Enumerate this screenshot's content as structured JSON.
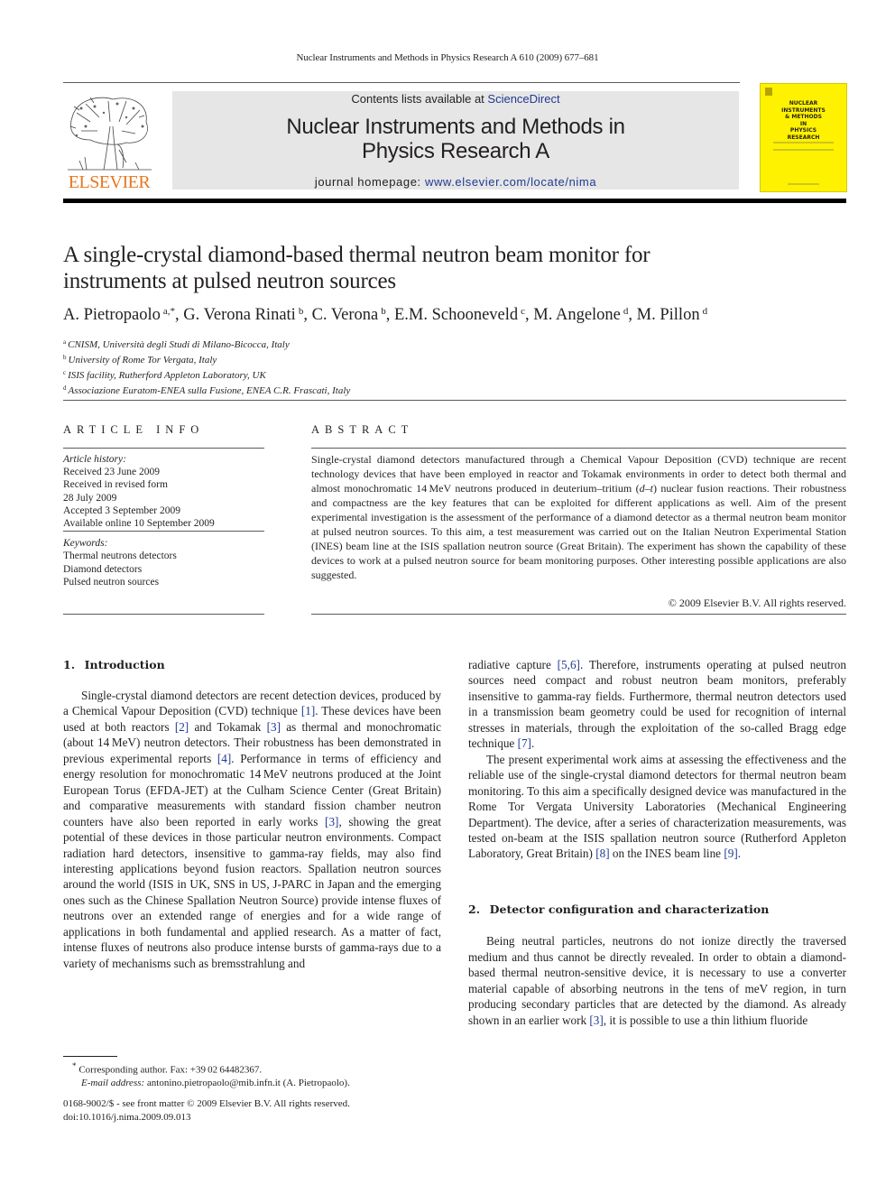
{
  "running_head": "Nuclear Instruments and Methods in Physics Research A 610 (2009) 677–681",
  "masthead": {
    "publisher_logo_text": "ELSEVIER",
    "contents_prefix": "Contents lists available at ",
    "contents_link": "ScienceDirect",
    "journal_title_line1": "Nuclear Instruments and Methods in",
    "journal_title_line2": "Physics Research A",
    "homepage_prefix": "journal homepage: ",
    "homepage_link": "www.elsevier.com/locate/nima",
    "cover_title_lines": [
      "NUCLEAR",
      "INSTRUMENTS",
      "& METHODS",
      "IN",
      "PHYSICS",
      "RESEARCH"
    ],
    "link_color": "#1f3a93",
    "logo_color": "#e87722",
    "cover_color": "#fff200"
  },
  "article": {
    "title_line1": "A single-crystal diamond-based thermal neutron beam monitor for",
    "title_line2": "instruments at pulsed neutron sources",
    "authors": [
      {
        "name": "A. Pietropaolo",
        "aff": "a,*"
      },
      {
        "name": "G. Verona Rinati",
        "aff": "b"
      },
      {
        "name": "C. Verona",
        "aff": "b"
      },
      {
        "name": "E.M. Schooneveld",
        "aff": "c"
      },
      {
        "name": "M. Angelone",
        "aff": "d"
      },
      {
        "name": "M. Pillon",
        "aff": "d"
      }
    ],
    "affiliations": [
      {
        "key": "a",
        "text": "CNISM, Università degli Studi di Milano-Bicocca, Italy"
      },
      {
        "key": "b",
        "text": "University of Rome Tor Vergata, Italy"
      },
      {
        "key": "c",
        "text": "ISIS facility, Rutherford Appleton Laboratory, UK"
      },
      {
        "key": "d",
        "text": "Associazione Euratom-ENEA sulla Fusione, ENEA C.R. Frascati, Italy"
      }
    ]
  },
  "article_info": {
    "heading": "ARTICLE INFO",
    "history_label": "Article history:",
    "history": [
      "Received 23 June 2009",
      "Received in revised form",
      "28 July 2009",
      "Accepted 3 September 2009",
      "Available online 10 September 2009"
    ],
    "keywords_label": "Keywords:",
    "keywords": [
      "Thermal neutrons detectors",
      "Diamond detectors",
      "Pulsed neutron sources"
    ]
  },
  "abstract": {
    "heading": "ABSTRACT",
    "text_part1": "Single-crystal diamond detectors manufactured through a Chemical Vapour Deposition (CVD) technique are recent technology devices that have been employed in reactor and Tokamak environments in order to detect both thermal and almost monochromatic 14 MeV neutrons produced in deuterium–tritium (",
    "text_italic": "d–t",
    "text_part2": ") nuclear fusion reactions. Their robustness and compactness are the key features that can be exploited for different applications as well. Aim of the present experimental investigation is the assessment of the performance of a diamond detector as a thermal neutron beam monitor at pulsed neutron sources. To this aim, a test measurement was carried out on the Italian Neutron Experimental Station (INES) beam line at the ISIS spallation neutron source (Great Britain). The experiment has shown the capability of these devices to work at a pulsed neutron source for beam monitoring purposes. Other interesting possible applications are also suggested.",
    "copyright": "© 2009 Elsevier B.V. All rights reserved."
  },
  "sections": {
    "intro_heading": "1.  Introduction",
    "intro_p1": [
      {
        "t": "Single-crystal diamond detectors are recent detection devices, produced by a Chemical Vapour Deposition (CVD) technique "
      },
      {
        "r": "[1]"
      },
      {
        "t": ". These devices have been used at both reactors "
      },
      {
        "r": "[2]"
      },
      {
        "t": " and Tokamak "
      },
      {
        "r": "[3]"
      },
      {
        "t": " as thermal and monochromatic (about 14 MeV) neutron detectors. Their robustness has been demonstrated in previous experimental reports "
      },
      {
        "r": "[4]"
      },
      {
        "t": ". Performance in terms of efficiency and energy resolution for monochromatic 14 MeV neutrons produced at the Joint European Torus (EFDA-JET) at the Culham Science Center (Great Britain) and comparative measurements with standard fission chamber neutron counters have also been reported in early works "
      },
      {
        "r": "[3]"
      },
      {
        "t": ", showing the great potential of these devices in those particular neutron environments. Compact radiation hard detectors, insensitive to gamma-ray fields, may also find interesting applications beyond fusion reactors. Spallation neutron sources around the world (ISIS in UK, SNS in US, J-PARC in Japan and the emerging ones such as the Chinese Spallation Neutron Source) provide intense fluxes of neutrons over an extended range of energies and for a wide range of applications in both fundamental and applied research. As a matter of fact, intense fluxes of neutrons also produce intense bursts of gamma-rays due to a variety of mechanisms such as bremsstrahlung and"
      }
    ],
    "right_p1": [
      {
        "t": "radiative capture "
      },
      {
        "r": "[5,6]"
      },
      {
        "t": ". Therefore, instruments operating at pulsed neutron sources need compact and robust neutron beam monitors, preferably insensitive to gamma-ray fields. Furthermore, thermal neutron detectors used in a transmission beam geometry could be used for recognition of internal stresses in materials, through the exploitation of the so-called Bragg edge technique "
      },
      {
        "r": "[7]"
      },
      {
        "t": "."
      }
    ],
    "right_p2": [
      {
        "t": "The present experimental work aims at assessing the effectiveness and the reliable use of the single-crystal diamond detectors for thermal neutron beam monitoring. To this aim a specifically designed device was manufactured in the Rome Tor Vergata University Laboratories (Mechanical Engineering Department). The device, after a series of characterization measurements, was tested on-beam at the ISIS spallation neutron source (Rutherford Appleton Laboratory, Great Britain) "
      },
      {
        "r": "[8]"
      },
      {
        "t": " on the INES beam line "
      },
      {
        "r": "[9]"
      },
      {
        "t": "."
      }
    ],
    "detector_heading": "2.  Detector configuration and characterization",
    "detector_p1": [
      {
        "t": "Being neutral particles, neutrons do not ionize directly the traversed medium and thus cannot be directly revealed. In order to obtain a diamond-based thermal neutron-sensitive device, it is necessary to use a converter material capable of absorbing neutrons in the tens of meV region, in turn producing secondary particles that are detected by the diamond. As already shown in an earlier work "
      },
      {
        "r": "[3]"
      },
      {
        "t": ", it is possible to use a thin lithium fluoride"
      }
    ]
  },
  "footnote": {
    "marker": "*",
    "corresponding": "Corresponding author. Fax: +39 02 64482367.",
    "email_label": "E-mail address:",
    "email": "antonino.pietropaolo@mib.infn.it",
    "email_suffix": " (A. Pietropaolo)."
  },
  "bottom": {
    "issn_line": "0168-9002/$ - see front matter © 2009 Elsevier B.V. All rights reserved.",
    "doi": "doi:10.1016/j.nima.2009.09.013"
  }
}
